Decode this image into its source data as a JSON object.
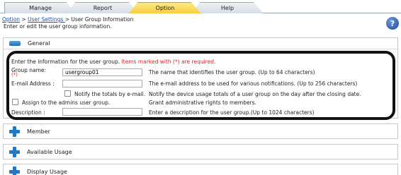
{
  "tabs": [
    {
      "label": "Manage"
    },
    {
      "label": "Report"
    },
    {
      "label": "Option"
    },
    {
      "label": "Help"
    }
  ],
  "breadcrumb": {
    "item1": "Option",
    "sep": " > ",
    "item2": "User Settings ",
    "current": "User Group Information"
  },
  "subtitle": "Enter or edit the user group information.",
  "help_icon": "question-icon",
  "general": {
    "title": "General",
    "instruction": "Enter the information for the user group. ",
    "required_note": "Items marked with (*) are required.",
    "group_name": {
      "label": "Group name:",
      "required_mark": "(*)",
      "value": "usergroup01",
      "description": "The name that identifies the user group. (Up to 64 characters)"
    },
    "email": {
      "label": "E-mail Address :",
      "value": "",
      "description": "The e-mail address to be used for various notifications. (Up to 256 characters)"
    },
    "notify": {
      "label": "Notify the totals by e-mail.",
      "checked": false,
      "description": "Notify the device usage totals of a user group on the day after the closing date."
    },
    "assign_admin": {
      "label": "Assign to the admins user group.",
      "checked": false,
      "description": "Grant administrative rights to members."
    },
    "description_field": {
      "label": "Description :",
      "value": "",
      "description": "Enter a description for the user group.(Up to 1024 characters)"
    }
  },
  "sections": {
    "member": "Member",
    "available_usage": "Available Usage",
    "display_usage": "Display Usage"
  },
  "colors": {
    "active_tab": "#f6cf3d",
    "link": "#1a4fb5",
    "required": "#e02020",
    "section_icon": "#1f78c8"
  }
}
